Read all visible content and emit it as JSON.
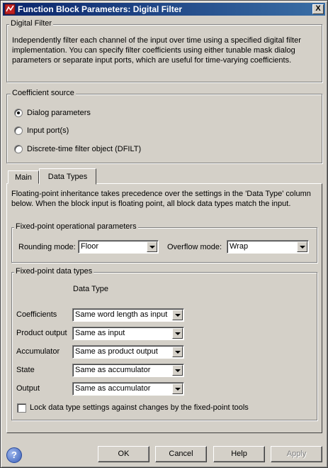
{
  "window": {
    "title": "Function Block Parameters: Digital Filter",
    "close_label": "X"
  },
  "header": {
    "group_label": "Digital Filter",
    "description_lines": [
      "Independently filter each channel of the input over time using a specified digital filter",
      "implementation. You can specify filter coefficients using either tunable mask dialog",
      "parameters or separate input ports, which are useful for time-varying coefficients."
    ]
  },
  "coefficient_source": {
    "group_label": "Coefficient source",
    "options": [
      "Dialog parameters",
      "Input port(s)",
      "Discrete-time filter object (DFILT)"
    ],
    "selected": "Dialog parameters"
  },
  "tabs": [
    {
      "label": "Main",
      "active": false
    },
    {
      "label": "Data Types",
      "active": true
    }
  ],
  "data_types": {
    "info_lines": [
      "Floating-point inheritance takes precedence over the settings in the 'Data Type' column",
      "below. When the block input is floating point, all block data types match the input."
    ],
    "fixed_point_params": {
      "group_label": "Fixed-point operational parameters",
      "rounding_label": "Rounding mode:",
      "rounding_value": "Floor",
      "overflow_label": "Overflow mode:",
      "overflow_value": "Wrap"
    },
    "fixed_point_types": {
      "group_label": "Fixed-point data types",
      "column_header": "Data Type",
      "rows": [
        {
          "label": "Coefficients",
          "value": "Same word length as input"
        },
        {
          "label": "Product output",
          "value": "Same as input"
        },
        {
          "label": "Accumulator",
          "value": "Same as product output"
        },
        {
          "label": "State",
          "value": "Same as accumulator"
        },
        {
          "label": "Output",
          "value": "Same as accumulator"
        }
      ],
      "lock_label": "Lock data type settings against changes by the fixed-point tools",
      "lock_checked": false
    }
  },
  "buttons": {
    "help_icon": "?",
    "ok": "OK",
    "cancel": "Cancel",
    "help": "Help",
    "apply": "Apply"
  }
}
